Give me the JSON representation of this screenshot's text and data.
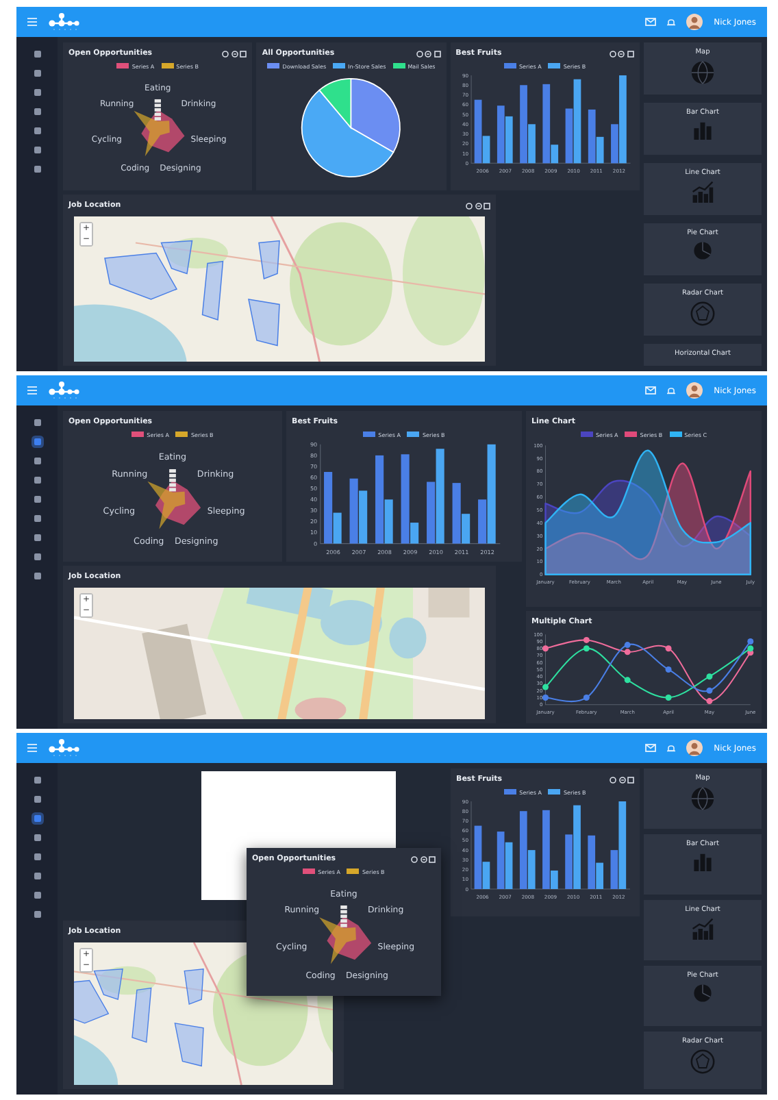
{
  "screens": [
    {
      "kind": "overview",
      "header": {
        "user_name": "Nick Jones"
      },
      "nav_rail": [
        {
          "selected": false
        },
        {
          "selected": false
        },
        {
          "selected": false
        },
        {
          "selected": false
        },
        {
          "selected": false
        },
        {
          "selected": false
        },
        {
          "selected": false
        }
      ],
      "panels": [
        {
          "kind": "radar",
          "title": "Open Opportunities",
          "show_tools": true,
          "legend": [
            {
              "label": "Series A",
              "color": "#e0507a"
            },
            {
              "label": "Series B",
              "color": "#d6a72a"
            }
          ],
          "axis_labels": [
            "Eating",
            "Running",
            "Drinking",
            "Cycling",
            "Sleeping",
            "Coding",
            "Designing"
          ]
        },
        {
          "kind": "pie",
          "title": "All Opportunities",
          "show_tools": true,
          "legend": [
            {
              "label": "Download Sales",
              "color": "#6b8ef2"
            },
            {
              "label": "In-Store Sales",
              "color": "#4aa9f5"
            },
            {
              "label": "Mail Sales",
              "color": "#2fe08c"
            }
          ]
        },
        {
          "kind": "chart",
          "title": "Best Fruits",
          "show_tools": true,
          "chart_data": {
            "type": "bar",
            "categories": [
              "2006",
              "2007",
              "2008",
              "2009",
              "2010",
              "2011",
              "2012"
            ],
            "series": [
              {
                "name": "Series A",
                "color": "#4a7fe6",
                "values": [
                  65,
                  59,
                  80,
                  81,
                  56,
                  55,
                  40
                ]
              },
              {
                "name": "Series B",
                "color": "#4aa6f2",
                "values": [
                  28,
                  48,
                  40,
                  19,
                  86,
                  27,
                  90
                ]
              }
            ],
            "ylim": [
              0,
              90
            ],
            "yticks": [
              0,
              10,
              20,
              30,
              40,
              50,
              60,
              70,
              80,
              90
            ]
          }
        },
        {
          "kind": "map",
          "title": "Job Location",
          "show_tools": true,
          "zoom_controls": [
            "+",
            "−"
          ]
        }
      ],
      "widgets": [
        {
          "label": "Map",
          "kind": "globe"
        },
        {
          "label": "Bar Chart",
          "kind": "bar"
        },
        {
          "label": "Line Chart",
          "kind": "line"
        },
        {
          "label": "Pie Chart",
          "kind": "pie"
        },
        {
          "label": "Radar Chart",
          "kind": "radar"
        },
        {
          "label": "Horizontal Chart",
          "kind": "none"
        }
      ]
    },
    {
      "kind": "with-line",
      "header": {
        "user_name": "Nick Jones"
      },
      "nav_rail": [
        {
          "selected": false
        },
        {
          "selected": true
        },
        {
          "selected": false
        },
        {
          "selected": false
        },
        {
          "selected": false
        },
        {
          "selected": false
        },
        {
          "selected": false
        },
        {
          "selected": false
        },
        {
          "selected": false
        }
      ],
      "panels": [
        {
          "kind": "radar",
          "title": "Open Opportunities",
          "show_tools": false,
          "legend": [
            {
              "label": "Series A",
              "color": "#e0507a"
            },
            {
              "label": "Series B",
              "color": "#d6a72a"
            }
          ],
          "axis_labels": [
            "Eating",
            "Running",
            "Drinking",
            "Cycling",
            "Sleeping",
            "Coding",
            "Designing"
          ]
        },
        {
          "kind": "chart",
          "title": "Best Fruits",
          "show_tools": false,
          "chart_data": {
            "type": "bar",
            "categories": [
              "2006",
              "2007",
              "2008",
              "2009",
              "2010",
              "2011",
              "2012"
            ],
            "series": [
              {
                "name": "Series A",
                "color": "#4a7fe6",
                "values": [
                  65,
                  59,
                  80,
                  81,
                  56,
                  55,
                  40
                ]
              },
              {
                "name": "Series B",
                "color": "#4aa6f2",
                "values": [
                  28,
                  48,
                  40,
                  19,
                  86,
                  27,
                  90
                ]
              }
            ],
            "ylim": [
              0,
              90
            ],
            "yticks": [
              0,
              10,
              20,
              30,
              40,
              50,
              60,
              70,
              80,
              90
            ]
          }
        },
        {
          "kind": "chart",
          "title": "Line Chart",
          "show_tools": false,
          "chart_data": {
            "type": "area",
            "categories": [
              "January",
              "February",
              "March",
              "April",
              "May",
              "June",
              "July"
            ],
            "series": [
              {
                "name": "Series A",
                "color": "#4b45c0",
                "values": [
                  55,
                  48,
                  72,
                  62,
                  22,
                  45,
                  30
                ]
              },
              {
                "name": "Series B",
                "color": "#e04a7a",
                "values": [
                  20,
                  32,
                  25,
                  15,
                  86,
                  20,
                  80
                ]
              },
              {
                "name": "Series C",
                "color": "#2fb4f5",
                "values": [
                  40,
                  62,
                  45,
                  96,
                  35,
                  25,
                  40
                ]
              }
            ],
            "ylim": [
              0,
              100
            ],
            "yticks": [
              0,
              10,
              20,
              30,
              40,
              50,
              60,
              70,
              80,
              90,
              100
            ]
          }
        },
        {
          "kind": "map",
          "title": "Job Location",
          "show_tools": false,
          "zoom_controls": [
            "+",
            "−"
          ]
        },
        {
          "kind": "chart",
          "title": "Multiple Chart",
          "show_tools": false,
          "chart_data": {
            "type": "line",
            "categories": [
              "January",
              "February",
              "March",
              "April",
              "May",
              "June"
            ],
            "series": [
              {
                "color": "#f06c9b",
                "marker": "circle",
                "values": [
                  80,
                  92,
                  75,
                  80,
                  5,
                  74
                ]
              },
              {
                "color": "#2ee0a0",
                "marker": "circle",
                "values": [
                  25,
                  80,
                  35,
                  10,
                  40,
                  80
                ]
              },
              {
                "color": "#4a7fe6",
                "marker": "circle",
                "values": [
                  10,
                  10,
                  85,
                  50,
                  20,
                  90
                ]
              }
            ],
            "ylim": [
              0,
              100
            ],
            "yticks": [
              0,
              10,
              20,
              30,
              40,
              50,
              60,
              70,
              80,
              90,
              100
            ]
          }
        }
      ]
    },
    {
      "kind": "dragging",
      "header": {
        "user_name": "Nick Jones"
      },
      "nav_rail": [
        {
          "selected": false
        },
        {
          "selected": false
        },
        {
          "selected": true
        },
        {
          "selected": false
        },
        {
          "selected": false
        },
        {
          "selected": false
        },
        {
          "selected": false
        },
        {
          "selected": false
        }
      ],
      "drop_placeholder": true,
      "panels": [
        {
          "kind": "radar",
          "title": "Open Opportunities",
          "show_tools": true,
          "legend": [
            {
              "label": "Series A",
              "color": "#e0507a"
            },
            {
              "label": "Series B",
              "color": "#d6a72a"
            }
          ],
          "axis_labels": [
            "Eating",
            "Running",
            "Drinking",
            "Cycling",
            "Sleeping",
            "Coding",
            "Designing"
          ]
        },
        {
          "kind": "chart",
          "title": "Best Fruits",
          "show_tools": true,
          "chart_data": {
            "type": "bar",
            "categories": [
              "2006",
              "2007",
              "2008",
              "2009",
              "2010",
              "2011",
              "2012"
            ],
            "series": [
              {
                "name": "Series A",
                "color": "#4a7fe6",
                "values": [
                  65,
                  59,
                  80,
                  81,
                  56,
                  55,
                  40
                ]
              },
              {
                "name": "Series B",
                "color": "#4aa6f2",
                "values": [
                  28,
                  48,
                  40,
                  19,
                  86,
                  27,
                  90
                ]
              }
            ],
            "ylim": [
              0,
              90
            ],
            "yticks": [
              0,
              10,
              20,
              30,
              40,
              50,
              60,
              70,
              80,
              90
            ]
          }
        },
        {
          "kind": "map",
          "title": "Job Location",
          "show_tools": false,
          "zoom_controls": [
            "+",
            "−"
          ]
        }
      ],
      "widgets": [
        {
          "label": "Map",
          "kind": "globe"
        },
        {
          "label": "Bar Chart",
          "kind": "bar"
        },
        {
          "label": "Line Chart",
          "kind": "line"
        },
        {
          "label": "Pie Chart",
          "kind": "pie"
        },
        {
          "label": "Radar Chart",
          "kind": "radar"
        }
      ]
    }
  ]
}
